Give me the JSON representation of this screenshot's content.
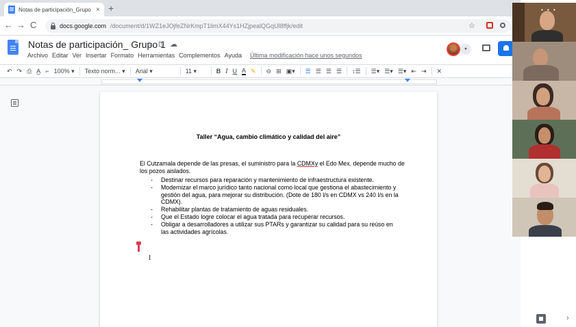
{
  "browser": {
    "tab_title": "Notas de participación_Grupo 1",
    "tab_close": "×",
    "new_tab": "+",
    "url_host": "docs.google.com",
    "url_path": "/document/d/1WZ1eJOjfeZNrKmpT1limX44Ys1HZjpealQGqUl8ffjk/edit",
    "back": "←",
    "forward": "→",
    "reload": "C",
    "star": "☆"
  },
  "docs": {
    "title": "Notas de participación_ Grupo 1",
    "title_icons": [
      "☆",
      "⊡",
      "☁"
    ],
    "menu": [
      "Archivo",
      "Editar",
      "Ver",
      "Insertar",
      "Formato",
      "Herramientas",
      "Complementos",
      "Ayuda"
    ],
    "last_edit": "Última modificación hace unos segundos"
  },
  "toolbar": {
    "zoom": "100%",
    "style": "Texto norm...",
    "font": "Arial",
    "size": "11",
    "bold": "B",
    "italic": "I",
    "underline": "U",
    "text_color": "A",
    "highlight": "✎"
  },
  "document": {
    "heading": "Taller “Agua, cambio climático y calidad del aire”",
    "para_pre": "El Cutzamala depende de las presas, el suministro para la ",
    "para_link": "CDMXy",
    "para_post": " el Edo Mex. depende mucho de los pozos aislados.",
    "bullets": [
      "Destinar recursos para reparación y mantenimiento de infraestructura existente.",
      "Modernizar el marco jurídico tanto nacional como local que gestiona el abastecimiento y gestión del agua, para mejorar su distribución. (Dote de 180 l/s en CDMX vs 240 l/s en la CDMX).",
      "Rehabilitar plantas de tratamiento de aguas residuales.",
      "Que el Estado logre colocar el agua tratada para recuperar recursos.",
      "Obligar a desarrolladores a utilizar sus PTARs y garantizar su calidad para su reúso en las actividades agrícolas."
    ]
  },
  "video": {
    "participant_count": 6,
    "menu_dots": "• • •"
  },
  "colors": {
    "docs_blue": "#4285f4",
    "share_blue": "#1a73e8",
    "cursor_red": "#d93f57"
  }
}
